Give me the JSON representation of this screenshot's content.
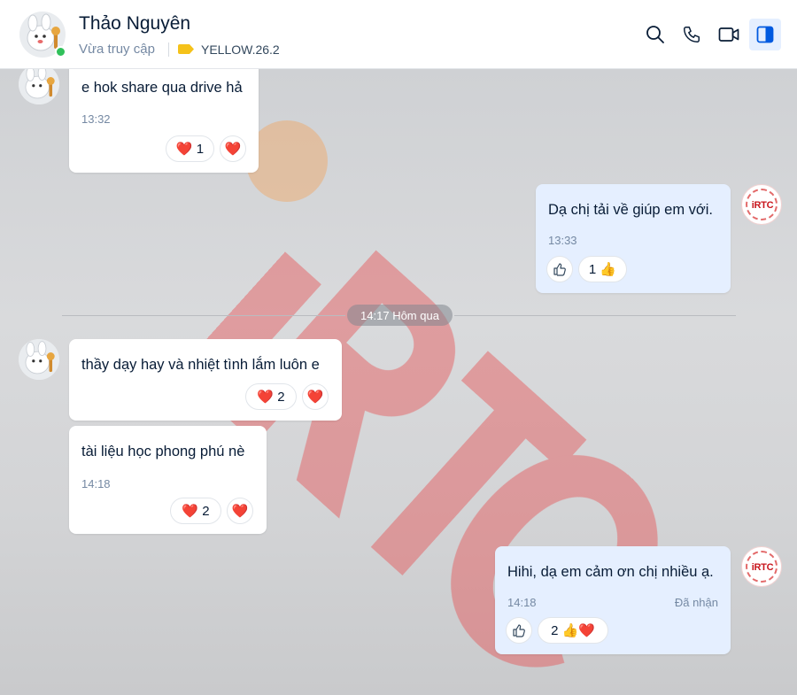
{
  "header": {
    "contact_name": "Thảo Nguyên",
    "presence": "Vừa truy cập",
    "label": "YELLOW.26.2",
    "label_color": "#F5C21A",
    "actions": [
      "search-icon",
      "phone-icon",
      "video-call-icon",
      "sidebar-toggle-icon"
    ]
  },
  "divider": {
    "label": "14:17 Hôm qua"
  },
  "watermark": {
    "text": "iRTC",
    "color": "#E8484A"
  },
  "brand_avatar": {
    "text": "iRTC"
  },
  "messages": [
    {
      "side": "in",
      "text": "e hok share qua drive hả",
      "time": "13:32",
      "reactions": [
        "❤️ 1",
        "❤️"
      ]
    },
    {
      "side": "out",
      "text": "Dạ chị tải về giúp em với.",
      "time": "13:33",
      "reactions": [
        "👍",
        "1 👍"
      ]
    },
    {
      "side": "in",
      "text": "thầy dạy hay và nhiệt tình lắm luôn e",
      "reactions": [
        "❤️ 2",
        "❤️"
      ]
    },
    {
      "side": "in",
      "text": "tài liệu học phong phú nè",
      "time": "14:18",
      "reactions": [
        "❤️ 2",
        "❤️"
      ]
    },
    {
      "side": "out",
      "text": "Hihi, dạ em cảm ơn chị nhiều ạ.",
      "time": "14:18",
      "status": "Đã nhận",
      "reactions": [
        "👍",
        "2 👍❤️"
      ]
    }
  ]
}
